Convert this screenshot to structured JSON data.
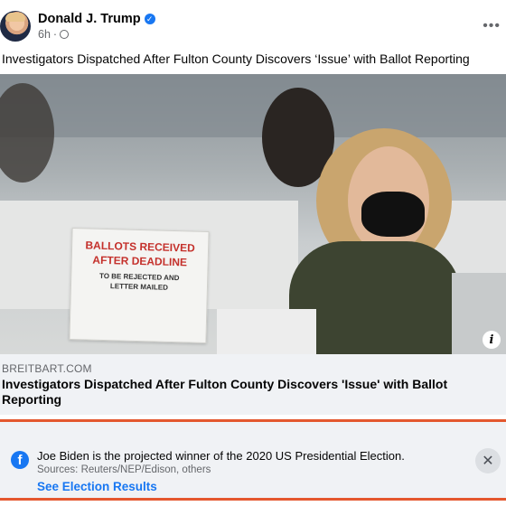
{
  "post": {
    "author": "Donald J. Trump",
    "time": "6h",
    "dot": "·",
    "text": "Investigators Dispatched After Fulton County Discovers ‘Issue’ with Ballot Reporting"
  },
  "image": {
    "sign_line1": "BALLOTS RECEIVED AFTER DEADLINE",
    "sign_line2": "TO BE REJECTED AND LETTER MAILED"
  },
  "link_preview": {
    "domain": "BREITBART.COM",
    "title": "Investigators Dispatched After Fulton County Discovers 'Issue' with Ballot Reporting"
  },
  "election_banner": {
    "message": "Joe Biden is the projected winner of the 2020 US Presidential Election.",
    "sources": "Sources: Reuters/NEP/Edison, others",
    "link": "See Election Results"
  },
  "icons": {
    "verified": "verified-badge-icon",
    "privacy": "globe-icon",
    "more": "more-options-icon",
    "info": "info-icon",
    "facebook": "facebook-icon",
    "close": "close-icon"
  },
  "colors": {
    "accent": "#1877f2",
    "banner_border": "#e4572e",
    "secondary_text": "#65676b"
  }
}
